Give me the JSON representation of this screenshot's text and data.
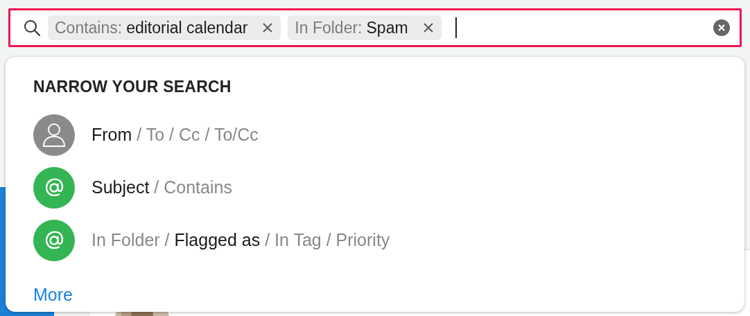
{
  "search": {
    "tokens": [
      {
        "label": "Contains:",
        "value": "editorial calendar"
      },
      {
        "label": "In Folder:",
        "value": "Spam"
      }
    ]
  },
  "suggestions": {
    "heading": "NARROW YOUR SEARCH",
    "items": [
      {
        "kind": "person",
        "parts": [
          {
            "text": "From",
            "emphasized": true
          },
          {
            "text": "/ To / Cc / To/Cc",
            "emphasized": false
          }
        ]
      },
      {
        "kind": "at",
        "parts": [
          {
            "text": "Subject",
            "emphasized": true
          },
          {
            "text": "/ Contains",
            "emphasized": false
          }
        ]
      },
      {
        "kind": "at",
        "parts": [
          {
            "text": "In Folder",
            "emphasized": false
          },
          {
            "text": "/",
            "emphasized": false
          },
          {
            "text": "Flagged as",
            "emphasized": true
          },
          {
            "text": "/ In Tag / Priority",
            "emphasized": false
          }
        ]
      }
    ],
    "more": "More"
  }
}
